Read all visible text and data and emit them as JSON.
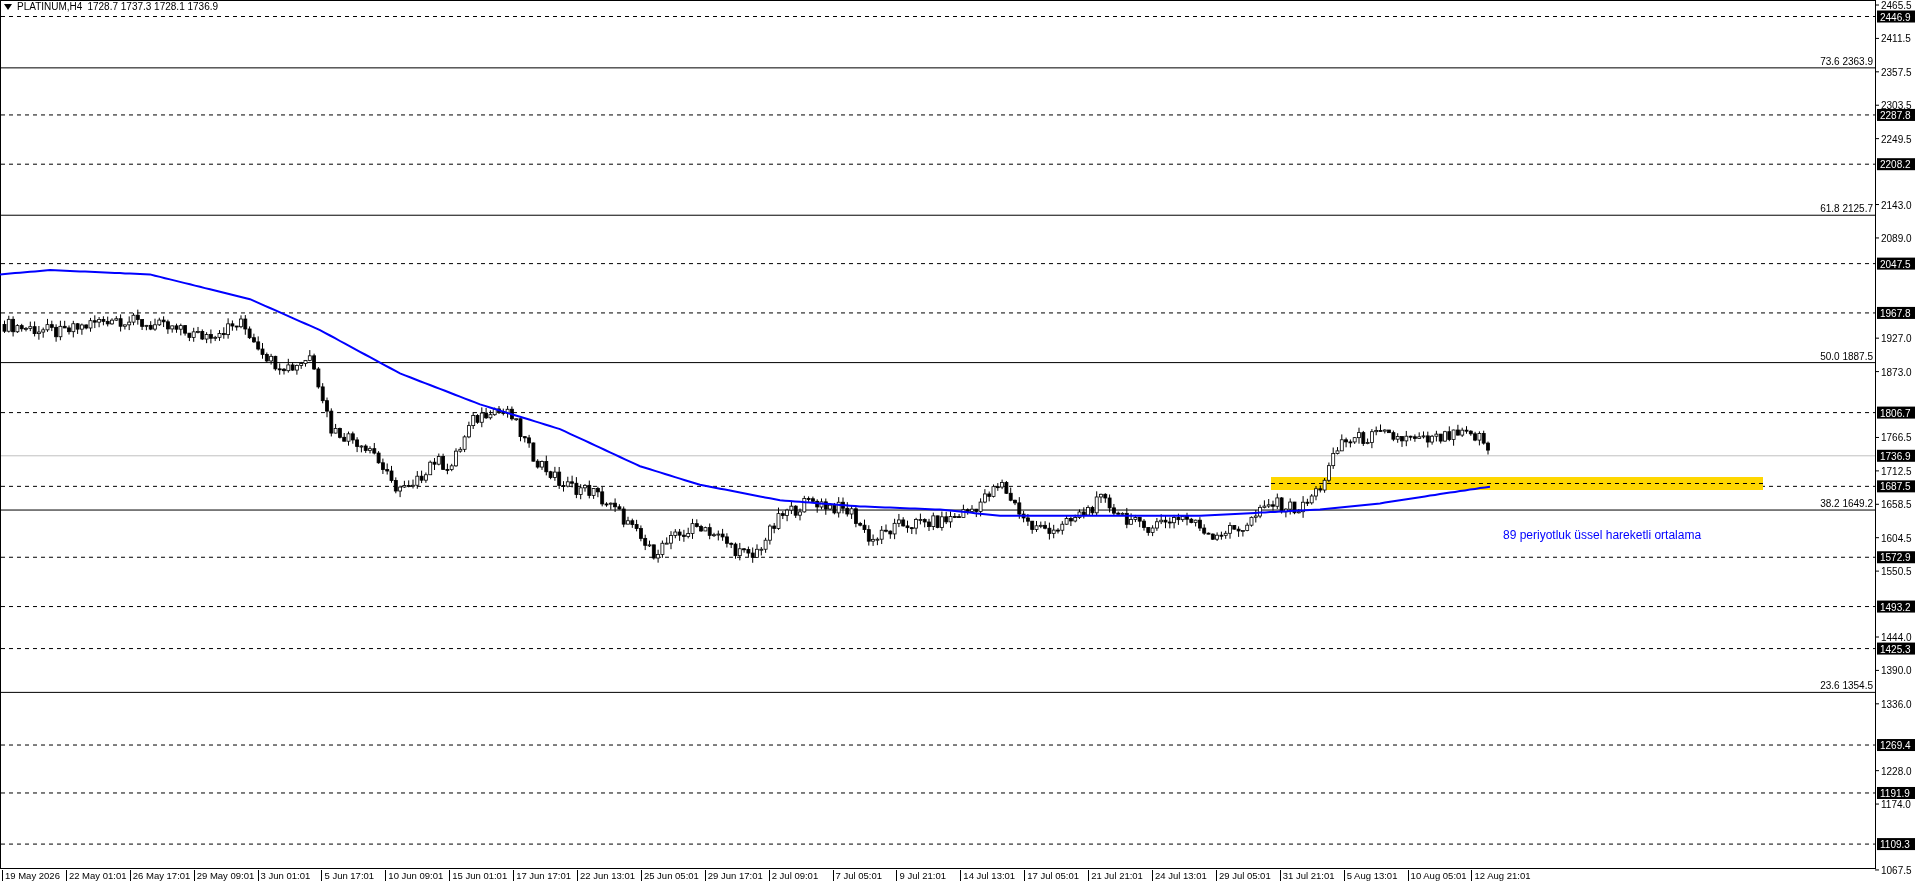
{
  "header": {
    "symbol": "PLATINUM,H4",
    "ohlc": "1728.7 1737.3 1728.1 1736.9"
  },
  "price_axis": {
    "ticks": [
      "2465.5",
      "2411.5",
      "2357.5",
      "2303.5",
      "2249.5",
      "2143.0",
      "2089.0",
      "1927.0",
      "1873.0",
      "1766.5",
      "1712.5",
      "1658.5",
      "1604.5",
      "1550.5",
      "1444.0",
      "1390.0",
      "1336.0",
      "1228.0",
      "1174.0",
      "1067.5"
    ]
  },
  "levels": [
    {
      "kind": "dashed",
      "label": "2446.9"
    },
    {
      "kind": "fibo",
      "label": "73.6 2363.9"
    },
    {
      "kind": "dashed",
      "label": "2287.8"
    },
    {
      "kind": "dashed",
      "label": "2208.2"
    },
    {
      "kind": "fibo",
      "label": "61.8 2125.7"
    },
    {
      "kind": "dashed",
      "label": "2047.5"
    },
    {
      "kind": "dashed",
      "label": "1967.8"
    },
    {
      "kind": "fibo",
      "label": "50.0 1887.5"
    },
    {
      "kind": "dashed",
      "label": "1806.7"
    },
    {
      "kind": "bid",
      "label": "1736.9"
    },
    {
      "kind": "dashed",
      "label": "1687.5"
    },
    {
      "kind": "fibo",
      "label": "38.2 1649.2"
    },
    {
      "kind": "dashed",
      "label": "1572.9"
    },
    {
      "kind": "dashed",
      "label": "1493.2"
    },
    {
      "kind": "dashed",
      "label": "1425.3"
    },
    {
      "kind": "fibo",
      "label": "23.6 1354.5"
    },
    {
      "kind": "dashed",
      "label": "1269.4"
    },
    {
      "kind": "dashed",
      "label": "1191.9"
    },
    {
      "kind": "dashed",
      "label": "1109.3"
    }
  ],
  "annotation": "89 periyotluk üssel hareketli ortalama",
  "time_axis": [
    "19 May 2026",
    "22 May 01:01",
    "26 May 17:01",
    "29 May 09:01",
    "3 Jun 01:01",
    "5 Jun 17:01",
    "10 Jun 09:01",
    "15 Jun 01:01",
    "17 Jun 17:01",
    "22 Jun 13:01",
    "25 Jun 05:01",
    "29 Jun 17:01",
    "2 Jul 09:01",
    "7 Jul 05:01",
    "9 Jul 21:01",
    "14 Jul 13:01",
    "17 Jul 05:01",
    "21 Jul 21:01",
    "24 Jul 13:01",
    "29 Jul 05:01",
    "31 Jul 21:01",
    "5 Aug 13:01",
    "10 Aug 05:01",
    "12 Aug 21:01"
  ]
}
